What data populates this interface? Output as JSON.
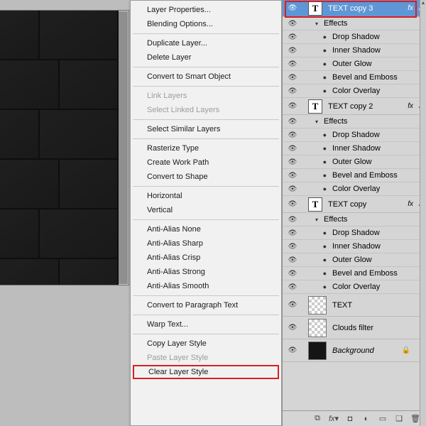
{
  "context_menu": {
    "groups": [
      [
        {
          "label": "Layer Properties...",
          "enabled": true
        },
        {
          "label": "Blending Options...",
          "enabled": true
        }
      ],
      [
        {
          "label": "Duplicate Layer...",
          "enabled": true
        },
        {
          "label": "Delete Layer",
          "enabled": true
        }
      ],
      [
        {
          "label": "Convert to Smart Object",
          "enabled": true
        }
      ],
      [
        {
          "label": "Link Layers",
          "enabled": false
        },
        {
          "label": "Select Linked Layers",
          "enabled": false
        }
      ],
      [
        {
          "label": "Select Similar Layers",
          "enabled": true
        }
      ],
      [
        {
          "label": "Rasterize Type",
          "enabled": true
        },
        {
          "label": "Create Work Path",
          "enabled": true
        },
        {
          "label": "Convert to Shape",
          "enabled": true
        }
      ],
      [
        {
          "label": "Horizontal",
          "enabled": true
        },
        {
          "label": "Vertical",
          "enabled": true
        }
      ],
      [
        {
          "label": "Anti-Alias None",
          "enabled": true
        },
        {
          "label": "Anti-Alias Sharp",
          "enabled": true
        },
        {
          "label": "Anti-Alias Crisp",
          "enabled": true
        },
        {
          "label": "Anti-Alias Strong",
          "enabled": true
        },
        {
          "label": "Anti-Alias Smooth",
          "enabled": true
        }
      ],
      [
        {
          "label": "Convert to Paragraph Text",
          "enabled": true
        }
      ],
      [
        {
          "label": "Warp Text...",
          "enabled": true
        }
      ],
      [
        {
          "label": "Copy Layer Style",
          "enabled": true
        },
        {
          "label": "Paste Layer Style",
          "enabled": false
        },
        {
          "label": "Clear Layer Style",
          "enabled": true,
          "highlight": true
        }
      ]
    ]
  },
  "effects_label": "Effects",
  "fx_text": "fx",
  "effect_items": [
    "Drop Shadow",
    "Inner Shadow",
    "Outer Glow",
    "Bevel and Emboss",
    "Color Overlay"
  ],
  "layers": {
    "text_copy_3": "TEXT copy 3",
    "text_copy_2": "TEXT copy 2",
    "text_copy": "TEXT copy",
    "text": "TEXT",
    "clouds_filter": "Clouds filter",
    "background": "Background"
  }
}
